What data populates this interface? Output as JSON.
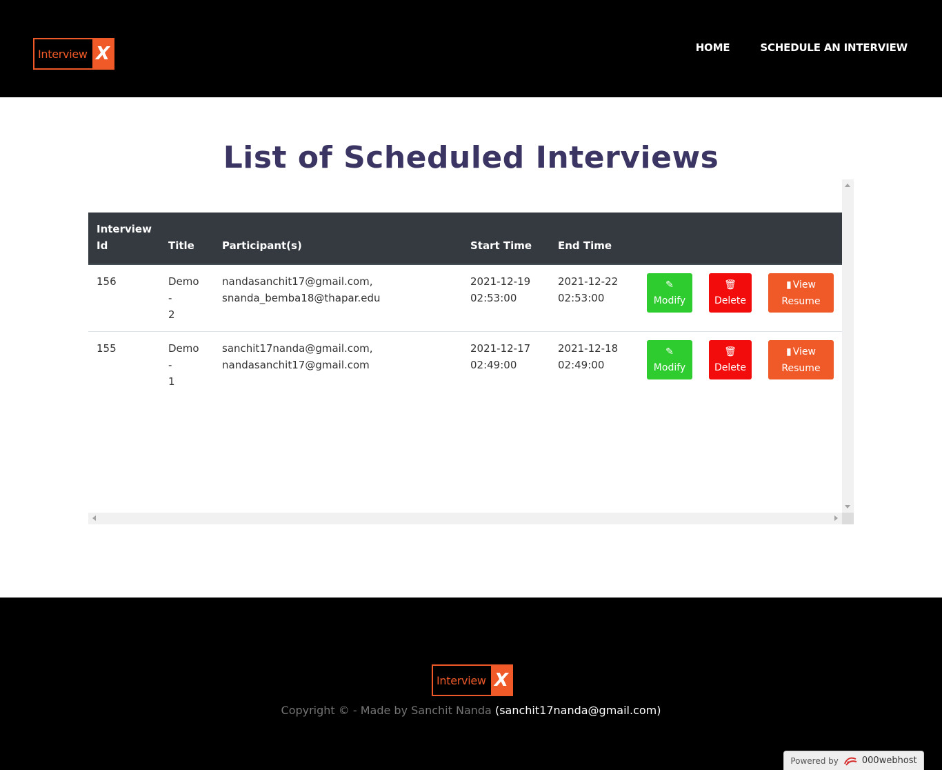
{
  "header": {
    "logo": {
      "text": "Interview",
      "mark": "X"
    },
    "nav": {
      "home": "HOME",
      "schedule": "SCHEDULE AN INTERVIEW"
    }
  },
  "page": {
    "title": "List of Scheduled Interviews"
  },
  "table": {
    "headers": {
      "id": "Interview Id",
      "title": "Title",
      "participants": "Participant(s)",
      "start": "Start Time",
      "end": "End Time"
    },
    "rows": [
      {
        "id": "156",
        "title": "Demo - 2",
        "participants": [
          "nandasanchit17@gmail.com,",
          "snanda_bemba18@thapar.edu"
        ],
        "start": [
          "2021-12-19",
          "02:53:00"
        ],
        "end": [
          "2021-12-22",
          "02:53:00"
        ]
      },
      {
        "id": "155",
        "title": "Demo - 1",
        "participants": [
          "sanchit17nanda@gmail.com,",
          "nandasanchit17@gmail.com"
        ],
        "start": [
          "2021-12-17",
          "02:49:00"
        ],
        "end": [
          "2021-12-18",
          "02:49:00"
        ]
      }
    ],
    "actions": {
      "modify": "Modify",
      "delete": "Delete",
      "resume_1": "View",
      "resume_2": "Resume"
    },
    "icons": {
      "modify": "pencil-icon",
      "delete": "trash-icon",
      "resume": "file-icon"
    }
  },
  "footer": {
    "logo": {
      "text": "Interview",
      "mark": "X"
    },
    "copyright": "Copyright © - Made by Sanchit Nanda",
    "email": "(sanchit17nanda@gmail.com)",
    "powered_label": "Powered by",
    "powered_host": "000webhost"
  },
  "colors": {
    "accent": "#f05a28",
    "title": "#3b3563",
    "modify": "#2ecc2e",
    "delete": "#f20c0c",
    "table_header": "#343a40"
  }
}
